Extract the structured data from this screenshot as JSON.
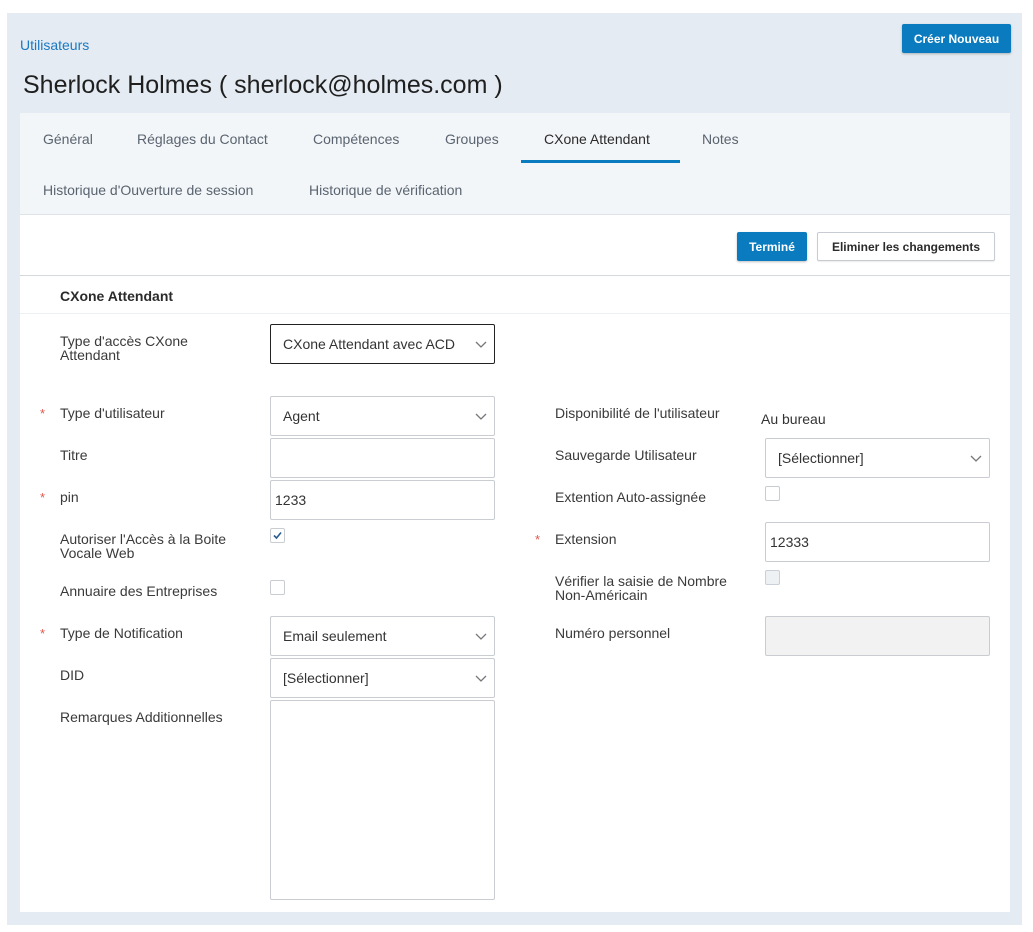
{
  "breadcrumb": "Utilisateurs",
  "page_title": "Sherlock Holmes ( sherlock@holmes.com )",
  "header": {
    "create_label": "Créer Nouveau"
  },
  "tabs": [
    {
      "label": "Général"
    },
    {
      "label": "Réglages du Contact"
    },
    {
      "label": "Compétences"
    },
    {
      "label": "Groupes"
    },
    {
      "label": "CXone Attendant",
      "active": true
    },
    {
      "label": "Notes"
    },
    {
      "label": "Historique d'Ouverture de session"
    },
    {
      "label": "Historique de vérification"
    }
  ],
  "toolbar": {
    "done_label": "Terminé",
    "discard_label": "Eliminer les changements"
  },
  "section_title": "CXone Attendant",
  "form": {
    "access_type": {
      "label": "Type d'accès CXone Attendant",
      "value": "CXone Attendant avec ACD"
    },
    "user_type": {
      "label": "Type d'utilisateur",
      "value": "Agent",
      "required": true
    },
    "title": {
      "label": "Titre",
      "value": ""
    },
    "pin": {
      "label": "pin",
      "value": "1233",
      "required": true
    },
    "voicemail_access": {
      "label": "Autoriser l'Accès à la Boite Vocale Web",
      "checked": true
    },
    "company_directory": {
      "label": "Annuaire des Entreprises",
      "checked": false
    },
    "notification_type": {
      "label": "Type de Notification",
      "value": "Email seulement",
      "required": true
    },
    "did": {
      "label": "DID",
      "value": "[Sélectionner]"
    },
    "remarks": {
      "label": "Remarques Additionnelles",
      "value": ""
    },
    "availability": {
      "label": "Disponibilité de l'utilisateur",
      "value": "Au bureau"
    },
    "user_backup": {
      "label": "Sauvegarde Utilisateur",
      "value": "[Sélectionner]"
    },
    "auto_extension": {
      "label": "Extention Auto-assignée",
      "checked": false
    },
    "extension": {
      "label": "Extension",
      "value": "12333",
      "required": true
    },
    "non_american": {
      "label": "Vérifier la saisie de Nombre Non-Américain",
      "checked": false
    },
    "personal_number": {
      "label": "Numéro personnel",
      "value": ""
    }
  },
  "required_marker": "*",
  "colors": {
    "accent": "#0a7bbf",
    "required": "#e2574c",
    "background": "#e4ebf2"
  }
}
